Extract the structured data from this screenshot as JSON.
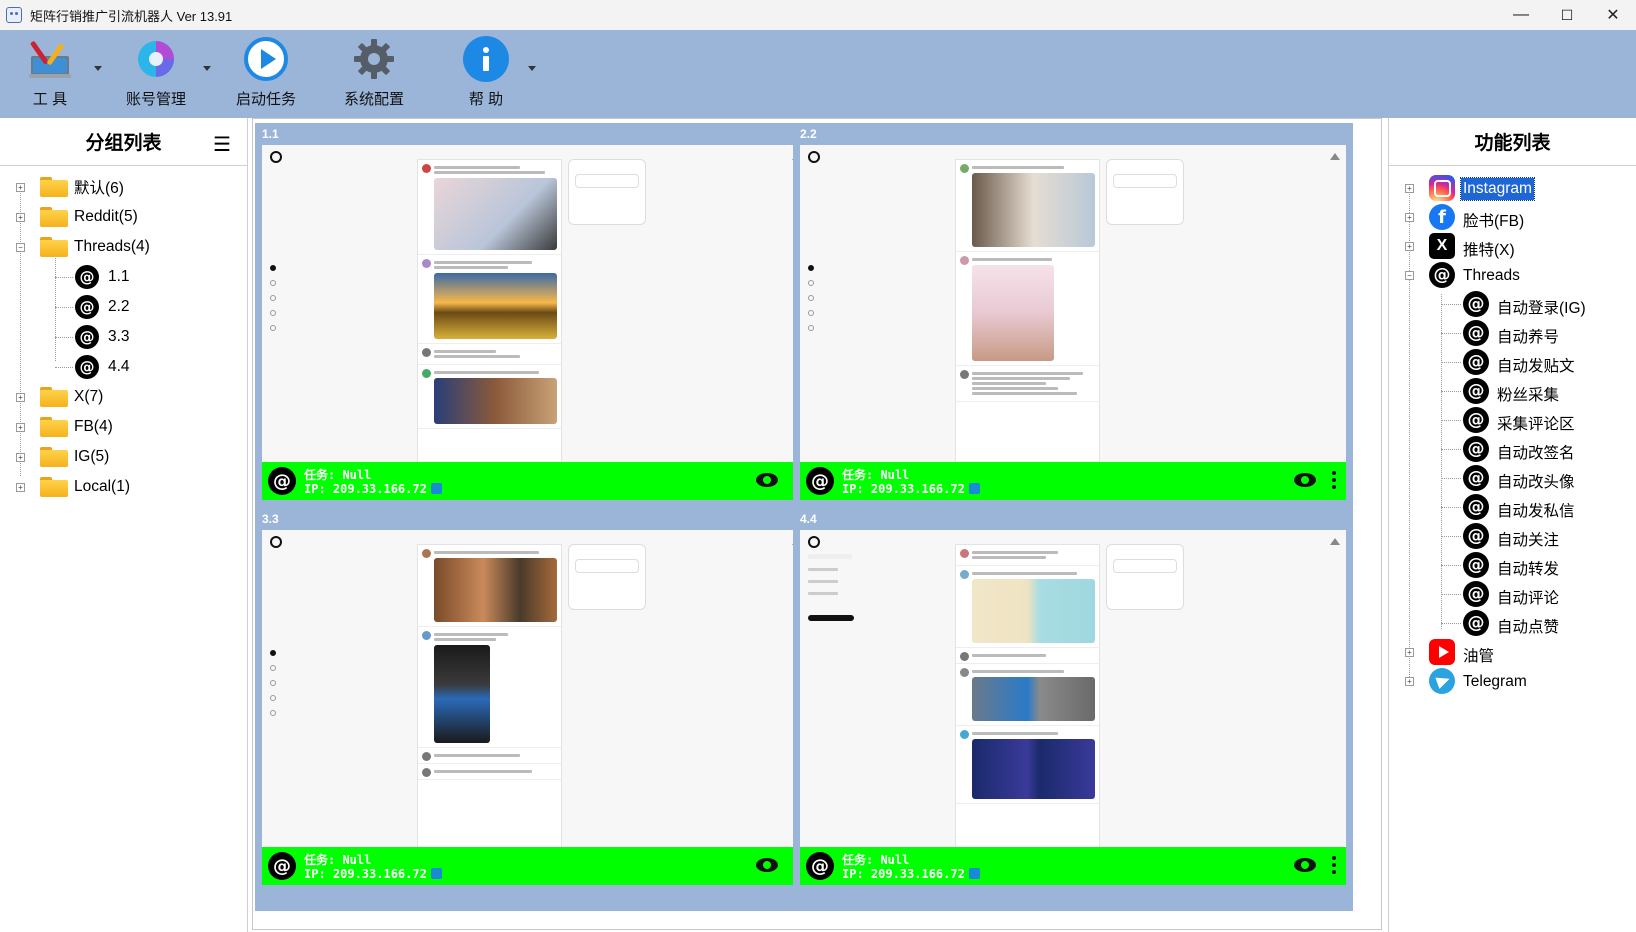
{
  "window": {
    "title": "矩阵行销推广引流机器人 Ver 13.91",
    "minimize": "—",
    "maximize": "☐",
    "close": "✕"
  },
  "toolbar": {
    "tools_label": "工  具",
    "accounts_label": "账号管理",
    "start_label": "启动任务",
    "settings_label": "系统配置",
    "help_label": "帮  助"
  },
  "groups": {
    "title": "分组列表",
    "menu_glyph": "☰",
    "items": [
      {
        "label": "默认(6)"
      },
      {
        "label": "Reddit(5)"
      },
      {
        "label": "Threads(4)",
        "children": [
          {
            "label": "1.1"
          },
          {
            "label": "2.2"
          },
          {
            "label": "3.3"
          },
          {
            "label": "4.4"
          }
        ]
      },
      {
        "label": "X(7)"
      },
      {
        "label": "FB(4)"
      },
      {
        "label": "IG(5)"
      },
      {
        "label": "Local(1)"
      }
    ]
  },
  "cells": [
    {
      "id": "1.1",
      "task": "任务: Null",
      "ip": "IP: 209.33.166.72"
    },
    {
      "id": "2.2",
      "task": "任务: Null",
      "ip": "IP: 209.33.166.72"
    },
    {
      "id": "3.3",
      "task": "任务: Null",
      "ip": "IP: 209.33.166.72"
    },
    {
      "id": "4.4",
      "task": "任务: Null",
      "ip": "IP: 209.33.166.72"
    }
  ],
  "functions": {
    "title": "功能列表",
    "platforms": [
      {
        "label": "Instagram",
        "icon": "instagram-icon",
        "selected": true
      },
      {
        "label": "脸书(FB)",
        "icon": "facebook-icon"
      },
      {
        "label": "推特(X)",
        "icon": "x-icon"
      },
      {
        "label": "Threads",
        "icon": "threads-icon",
        "children": [
          {
            "label": "自动登录(IG)"
          },
          {
            "label": "自动养号"
          },
          {
            "label": "自动发贴文"
          },
          {
            "label": "粉丝采集"
          },
          {
            "label": "采集评论区"
          },
          {
            "label": "自动改签名"
          },
          {
            "label": "自动改头像"
          },
          {
            "label": "自动发私信"
          },
          {
            "label": "自动关注"
          },
          {
            "label": "自动转发"
          },
          {
            "label": "自动评论"
          },
          {
            "label": "自动点赞"
          }
        ]
      },
      {
        "label": "油管",
        "icon": "youtube-icon"
      },
      {
        "label": "Telegram",
        "icon": "telegram-icon"
      }
    ]
  },
  "colors": {
    "toolbar_bg": "#9bb5d9",
    "status_green": "#00ff00",
    "selection_blue": "#1e66d6"
  }
}
